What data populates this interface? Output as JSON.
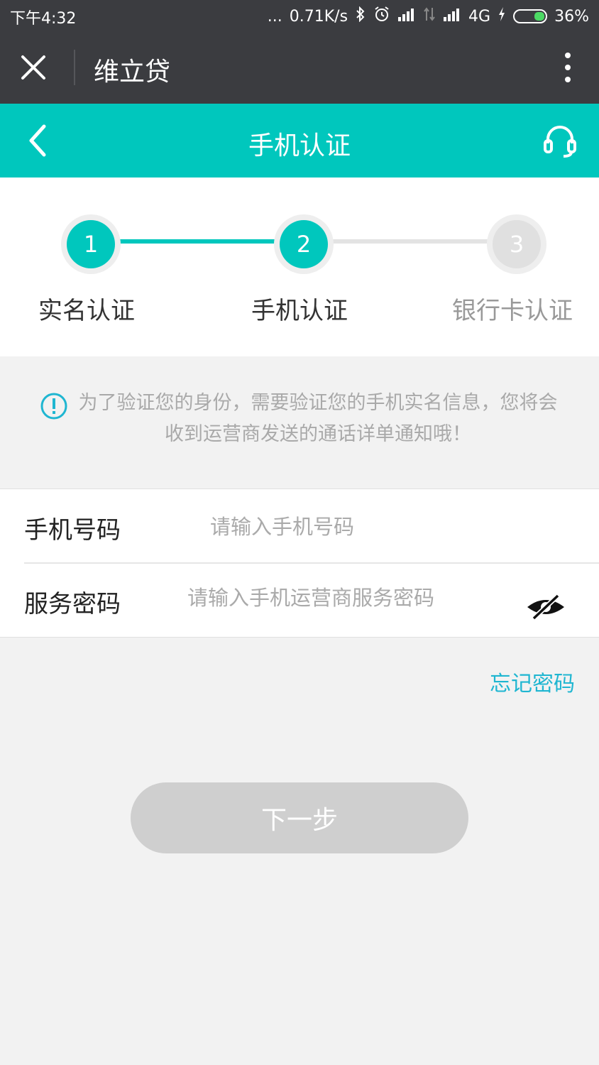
{
  "status_bar": {
    "time": "下午4:32",
    "dots": "...",
    "network_speed": "0.71K/s",
    "network_type": "4G",
    "battery_percent": "36%"
  },
  "webview": {
    "title": "维立贷"
  },
  "navbar": {
    "title": "手机认证"
  },
  "steps": [
    {
      "number": "1",
      "label": "实名认证",
      "state": "done"
    },
    {
      "number": "2",
      "label": "手机认证",
      "state": "active"
    },
    {
      "number": "3",
      "label": "银行卡认证",
      "state": "pending"
    }
  ],
  "notice": {
    "text": "为了验证您的身份，需要验证您的手机实名信息，您将会收到运营商发送的通话详单通知哦！"
  },
  "form": {
    "phone_label": "手机号码",
    "phone_placeholder": "请输入手机号码",
    "password_label": "服务密码",
    "password_placeholder": "请输入手机运营商服务密码"
  },
  "forgot_label": "忘记密码",
  "next_label": "下一步",
  "colors": {
    "accent": "#00c7bd",
    "header_bg": "#3b3c40",
    "link": "#1fb6d1",
    "disabled_button": "#cfcfcf"
  }
}
